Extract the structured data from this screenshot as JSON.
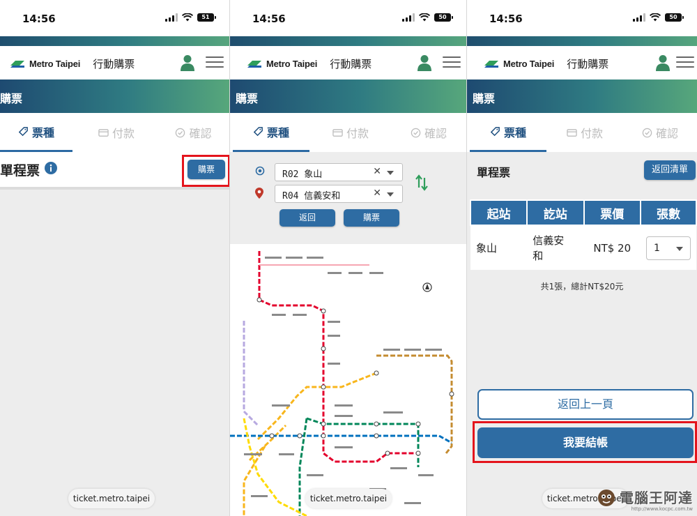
{
  "status": {
    "time": "14:56",
    "battery_1": "51",
    "battery_2": "50",
    "battery_3": "50"
  },
  "brand": {
    "logo_text": "Metro Taipei",
    "app_name": "行動購票",
    "accent": "#2e6ca3",
    "highlight": "#e4141c"
  },
  "tabs": {
    "ticket_type": "票種",
    "payment": "付款",
    "confirm": "確認"
  },
  "panel1": {
    "band_title": "購票",
    "ticket_label": "單程票",
    "info_icon": "info-icon",
    "buy_button": "購票",
    "url": "ticket.metro.taipei"
  },
  "panel2": {
    "band_title": "購票",
    "origin": "R02 象山",
    "destination": "R04 信義安和",
    "back_button": "返回",
    "buy_button": "購票",
    "url": "ticket.metro.taipei"
  },
  "panel3": {
    "band_title": "購票",
    "ticket_label": "單程票",
    "return_list_button": "返回清單",
    "table": {
      "headers": [
        "起站",
        "訖站",
        "票價",
        "張數"
      ],
      "row": {
        "from": "象山",
        "to": "信義安和",
        "price": "NT$ 20",
        "qty": "1"
      }
    },
    "summary": "共1張，總計NT$20元",
    "prev_page_button": "返回上一頁",
    "checkout_button": "我要結帳",
    "url": "ticket.metro.taipei"
  },
  "watermark": {
    "text": "電腦王阿達",
    "url": "http://www.kocpc.com.tw"
  }
}
